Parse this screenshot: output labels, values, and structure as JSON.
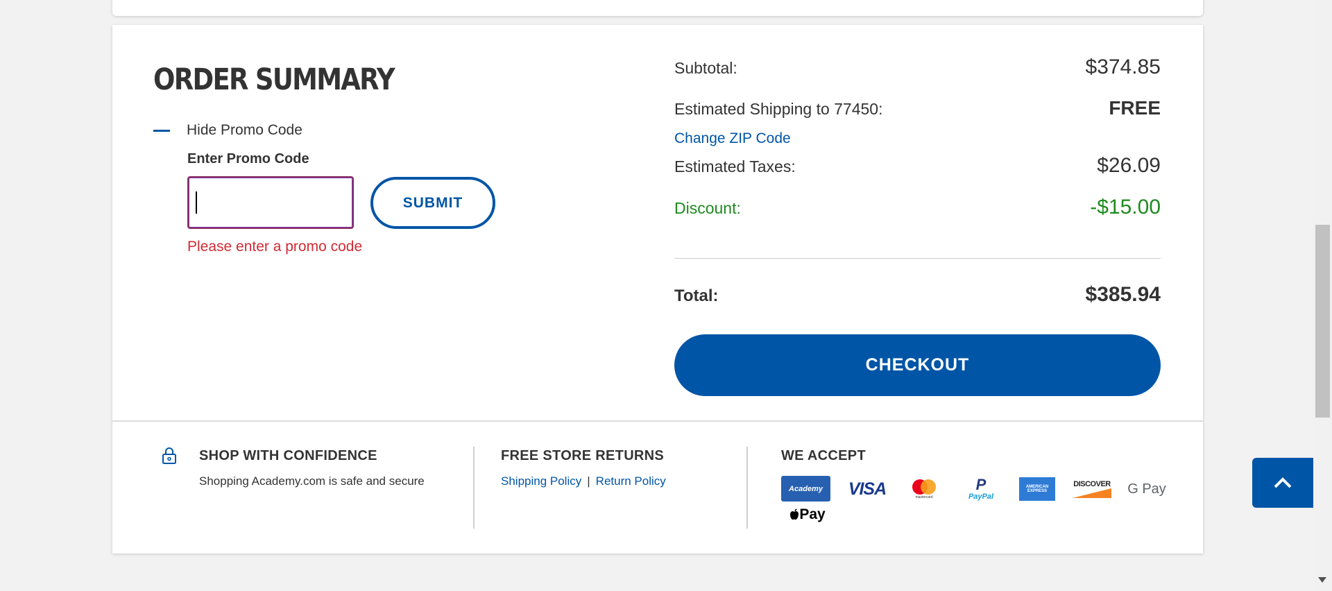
{
  "order_summary": {
    "title": "ORDER SUMMARY",
    "promo_toggle_label": "Hide Promo Code",
    "promo_field_label": "Enter Promo Code",
    "promo_input_value": "",
    "submit_label": "SUBMIT",
    "promo_error": "Please enter a promo code"
  },
  "totals": {
    "subtotal_label": "Subtotal:",
    "subtotal_value": "$374.85",
    "shipping_label": "Estimated Shipping to 77450:",
    "shipping_value": "FREE",
    "change_zip_label": "Change ZIP Code",
    "taxes_label": "Estimated Taxes:",
    "taxes_value": "$26.09",
    "discount_label": "Discount:",
    "discount_value": "-$15.00",
    "total_label": "Total:",
    "total_value": "$385.94",
    "checkout_label": "CHECKOUT",
    "discount_color": "#1e8a1e",
    "accent_color": "#0055a6"
  },
  "footer": {
    "confidence_heading": "SHOP WITH CONFIDENCE",
    "confidence_text": "Shopping Academy.com is safe and secure",
    "returns_heading": "FREE STORE RETURNS",
    "shipping_policy_link": "Shipping Policy",
    "separator": "|",
    "return_policy_link": "Return Policy",
    "accept_heading": "WE ACCEPT",
    "payment_methods": {
      "academy": "Academy",
      "visa": "VISA",
      "mastercard": "mastercard",
      "paypal": "PayPal",
      "amex": "AMERICAN EXPRESS",
      "discover": "DISCOVER",
      "gpay": "G Pay",
      "applepay": "Pay"
    }
  },
  "icons": {
    "lock": "lock-icon",
    "minus": "minus-icon",
    "chevron_up": "chevron-up-icon"
  }
}
